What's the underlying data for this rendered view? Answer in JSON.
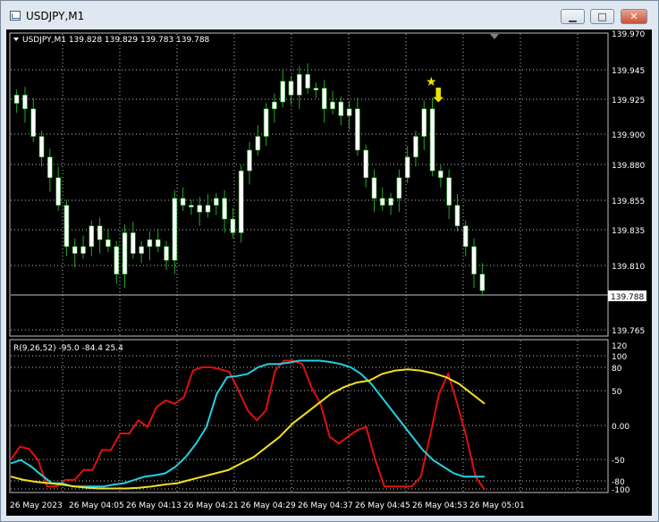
{
  "window": {
    "title": "USDJPY,M1",
    "min_glyph": "▁",
    "max_glyph": "□",
    "close_glyph": "✕"
  },
  "price_panel": {
    "header": "USDJPY,M1  139.828 139.829 139.783 139.788",
    "current_price": "139.788",
    "y_ticks": [
      "139.970",
      "139.945",
      "139.925",
      "139.900",
      "139.880",
      "139.855",
      "139.835",
      "139.810",
      "139.765"
    ],
    "arrow_glyph": "⬇",
    "star_glyph": "★"
  },
  "indicator_panel": {
    "label": "R(9,26,52) -95.0 -84.4 25.4",
    "y_ticks": [
      "120",
      "100",
      "80",
      "50",
      "0.00",
      "-50",
      "-80",
      "-100"
    ]
  },
  "x_axis": {
    "labels": [
      "26 May 2023",
      "26 May 04:05",
      "26 May 04:13",
      "26 May 04:21",
      "26 May 04:29",
      "26 May 04:37",
      "26 May 04:45",
      "26 May 04:53",
      "26 May 05:01"
    ]
  },
  "colors": {
    "background": "#000000",
    "grid": "#c0c0c0",
    "candle": "#ffffff",
    "wick": "#22aa22",
    "fast_line": "#e01010",
    "mid_line": "#22d0e0",
    "slow_line": "#f0e020",
    "marker": "#f0e000"
  },
  "chart_data": {
    "type": "candlestick",
    "title": "USDJPY,M1",
    "ohlc_last": {
      "open": 139.828,
      "high": 139.829,
      "low": 139.783,
      "close": 139.788
    },
    "price_ylim": [
      139.755,
      139.975
    ],
    "closes": [
      139.93,
      139.92,
      139.9,
      139.885,
      139.87,
      139.85,
      139.82,
      139.815,
      139.82,
      139.835,
      139.825,
      139.82,
      139.8,
      139.83,
      139.815,
      139.82,
      139.825,
      139.82,
      139.81,
      139.855,
      139.85,
      139.85,
      139.845,
      139.85,
      139.855,
      139.84,
      139.83,
      139.875,
      139.89,
      139.9,
      139.92,
      139.925,
      139.94,
      139.93,
      139.945,
      139.935,
      139.935,
      139.92,
      139.925,
      139.915,
      139.92,
      139.89,
      139.87,
      139.855,
      139.85,
      139.855,
      139.87,
      139.885,
      139.9,
      139.92,
      139.875,
      139.87,
      139.85,
      139.835,
      139.82,
      139.8,
      139.788
    ],
    "indicator": {
      "name": "R(9,26,52)",
      "ylim": [
        -100,
        120
      ],
      "series": [
        {
          "name": "R9",
          "values": [
            -55,
            -35,
            -38,
            -55,
            -95,
            -95,
            -85,
            -85,
            -70,
            -70,
            -40,
            -40,
            -15,
            -15,
            5,
            -5,
            25,
            35,
            30,
            40,
            80,
            85,
            85,
            82,
            78,
            50,
            20,
            5,
            20,
            80,
            95,
            95,
            90,
            55,
            30,
            -20,
            -30,
            -20,
            -10,
            -5,
            -55,
            -95,
            -95,
            -95,
            -95,
            -80,
            -20,
            45,
            75,
            30,
            -20,
            -80,
            -100
          ]
        },
        {
          "name": "R26",
          "values": [
            -60,
            -55,
            -65,
            -78,
            -90,
            -90,
            -95,
            -95,
            -95,
            -95,
            -92,
            -90,
            -85,
            -80,
            -78,
            -75,
            -65,
            -50,
            -30,
            -5,
            45,
            70,
            72,
            75,
            85,
            90,
            90,
            92,
            95,
            95,
            95,
            93,
            90,
            85,
            75,
            60,
            40,
            20,
            0,
            -20,
            -40,
            -55,
            -65,
            -75,
            -80,
            -80,
            -80
          ]
        },
        {
          "name": "R52",
          "values": [
            -80,
            -85,
            -88,
            -90,
            -92,
            -95,
            -97,
            -98,
            -98,
            -98,
            -97,
            -95,
            -92,
            -90,
            -85,
            -80,
            -75,
            -70,
            -60,
            -50,
            -35,
            -20,
            0,
            15,
            30,
            45,
            55,
            62,
            65,
            75,
            80,
            82,
            80,
            76,
            70,
            60,
            45,
            30
          ]
        }
      ]
    }
  }
}
